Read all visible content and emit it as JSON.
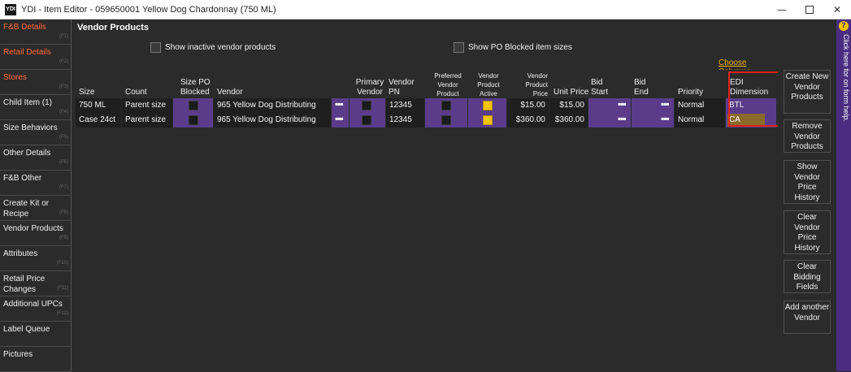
{
  "window": {
    "logo": "YDI",
    "title": "YDI - Item Editor - 059650001 Yellow Dog Chardonnay (750 ML)",
    "min_icon": "minimize-icon",
    "max_icon": "maximize-icon",
    "close_icon": "close-icon"
  },
  "sidebar": {
    "items": [
      {
        "label": "F&B Details",
        "key": "(F1)",
        "color": "red"
      },
      {
        "label": "Retail Details",
        "key": "(F2)",
        "color": "red"
      },
      {
        "label": "Stores",
        "key": "(F3)",
        "color": "red"
      },
      {
        "label": "Child Item (1)",
        "key": "(F4)"
      },
      {
        "label": "Size Behaviors",
        "key": "(F5)"
      },
      {
        "label": "Other Details",
        "key": "(F6)"
      },
      {
        "label": "F&B Other",
        "key": "(F7)"
      },
      {
        "label": "Create Kit or Recipe",
        "key": "(F8)"
      },
      {
        "label": "Vendor Products",
        "key": "(F9)"
      },
      {
        "label": "Attributes",
        "key": "(F10)"
      },
      {
        "label": "Retail Price Changes",
        "key": "(F11)"
      },
      {
        "label": "Additional UPCs",
        "key": "(F12)"
      },
      {
        "label": "Label Queue",
        "key": ""
      },
      {
        "label": "Pictures",
        "key": ""
      }
    ]
  },
  "main": {
    "section_title": "Vendor Products",
    "show_inactive_label": "Show inactive vendor products",
    "show_po_blocked_label": "Show PO Blocked item sizes",
    "choose_columns": "Choose Columns"
  },
  "grid": {
    "headers": {
      "size": "Size",
      "count": "Count",
      "size_po_blocked": "Size PO Blocked",
      "vendor": "Vendor",
      "primary_vendor": "Primary Vendor",
      "vendor_pn": "Vendor PN",
      "preferred_vendor_product": "Preferred Vendor Product",
      "vendor_product_active": "Vendor Product Active",
      "vendor_product_price": "Vendor Product Price",
      "unit_price": "Unit Price",
      "bid_start": "Bid Start",
      "bid_end": "Bid End",
      "priority": "Priority",
      "edi_dimension": "EDI Dimension"
    },
    "rows": [
      {
        "size": "750 ML",
        "count": "Parent size",
        "vendor": "965 Yellow Dog Distributing",
        "vendor_pn": "12345",
        "vendor_product_price": "$15.00",
        "unit_price": "$15.00",
        "priority": "Normal",
        "edi_dimension": "BTL",
        "product_active": true
      },
      {
        "size": "Case 24ct",
        "count": "Parent size",
        "vendor": "965 Yellow Dog Distributing",
        "vendor_pn": "12345",
        "vendor_product_price": "$360.00",
        "unit_price": "$360.00",
        "priority": "Normal",
        "edi_dimension": "CA",
        "product_active": true
      }
    ],
    "dots": "▪▪▪"
  },
  "actions": {
    "create": "Create New Vendor Products",
    "remove": "Remove Vendor Products",
    "show_history": "Show Vendor Price History",
    "clear_history": "Clear Vendor Price History",
    "clear_bidding": "Clear Bidding Fields",
    "add_vendor": "Add another Vendor"
  },
  "help": {
    "icon": "?",
    "text": "Click here for on form help."
  },
  "colors": {
    "accent_purple": "#5a3c8a",
    "active_yellow": "#f5c400",
    "tab_red": "#ff6a3a",
    "highlight_box": "#e0221a"
  }
}
